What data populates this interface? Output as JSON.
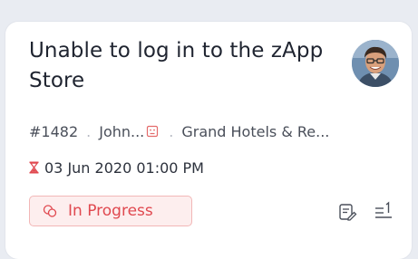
{
  "ticket": {
    "title": "Unable to log in to the zApp Store",
    "number": "#1482",
    "contact": "John...",
    "separator": ".",
    "account": "Grand Hotels & Re...",
    "due_date": "03 Jun 2020 01:00 PM",
    "status": "In Progress"
  },
  "icons": {
    "avatar": "contact-avatar",
    "sentiment": "neutral-face-icon",
    "due": "hourglass-icon",
    "status": "status-bubble-icon",
    "edit": "edit-note-icon",
    "priority": "priority-list-icon"
  },
  "colors": {
    "status_text": "#e0484f",
    "status_bg": "#fdeeee",
    "status_border": "#f2b7b7",
    "sentiment_icon": "#e46b6b",
    "due_icon": "#e0484f"
  }
}
